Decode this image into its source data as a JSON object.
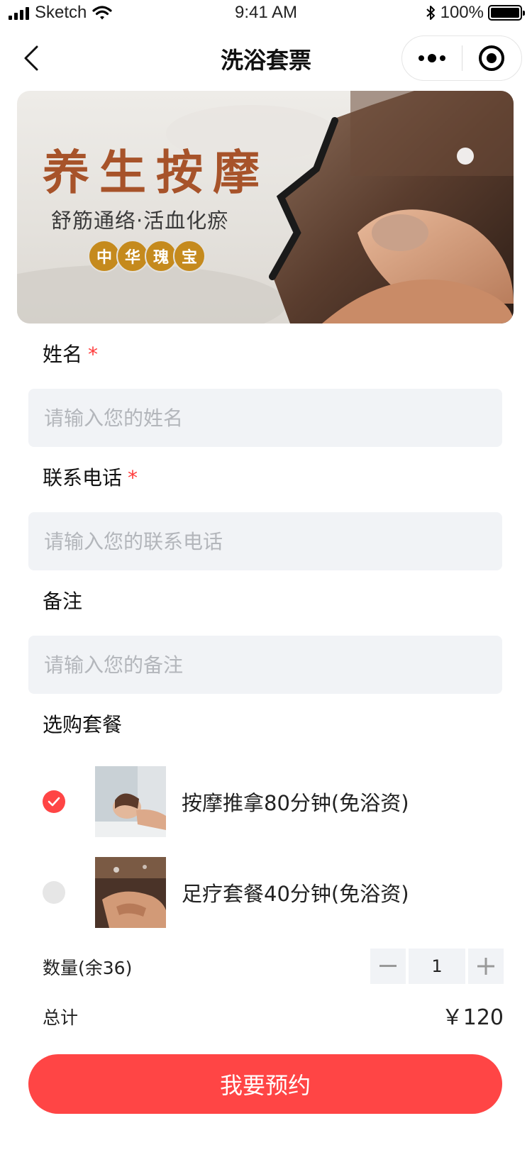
{
  "status_bar": {
    "carrier": "Sketch",
    "time": "9:41 AM",
    "battery": "100%",
    "battery_level": 1.0
  },
  "nav": {
    "title": "洗浴套票"
  },
  "banner": {
    "title": "养生按摩",
    "subtitle": "舒筋通络·活血化瘀",
    "badges": [
      "中",
      "华",
      "瑰",
      "宝"
    ]
  },
  "form": {
    "name": {
      "label": "姓名",
      "required_mark": "*",
      "placeholder": "请输入您的姓名"
    },
    "phone": {
      "label": "联系电话",
      "required_mark": "*",
      "placeholder": "请输入您的联系电话"
    },
    "note": {
      "label": "备注",
      "placeholder": "请输入您的备注"
    }
  },
  "packages": {
    "label": "选购套餐",
    "items": [
      {
        "name": "按摩推拿80分钟(免浴资)",
        "selected": true
      },
      {
        "name": "足疗套餐40分钟(免浴资)",
        "selected": false
      }
    ]
  },
  "quantity": {
    "label": "数量(余36)",
    "value": "1"
  },
  "total": {
    "label": "总计",
    "value": "￥120"
  },
  "submit_label": "我要预约",
  "colors": {
    "accent": "#ff4545",
    "input_bg": "#f1f3f6",
    "badge": "#c58a1d"
  }
}
